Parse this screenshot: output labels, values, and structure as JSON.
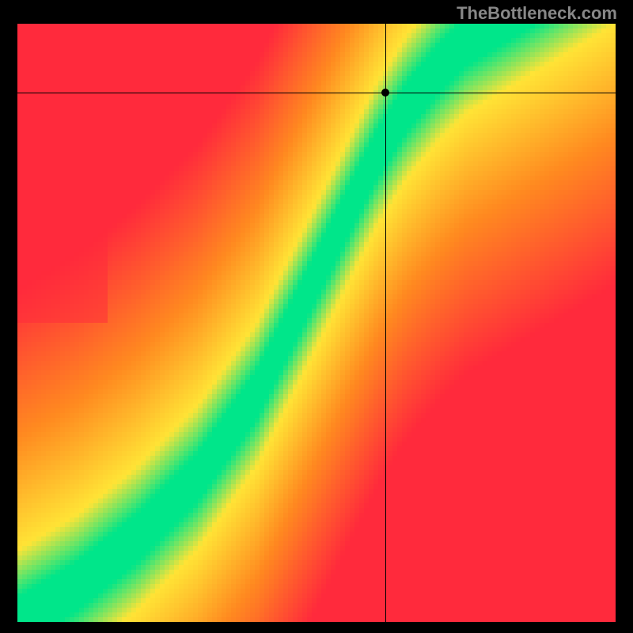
{
  "watermark": "TheBottleneck.com",
  "chart_data": {
    "type": "heatmap",
    "title": "",
    "xlabel": "",
    "ylabel": "",
    "xlim": [
      0,
      1
    ],
    "ylim": [
      0,
      1
    ],
    "grid": false,
    "crosshair": {
      "x": 0.615,
      "y": 0.885
    },
    "marker": {
      "x": 0.615,
      "y": 0.885
    },
    "optimal_curve_description": "Heatmap shading from red (poor) through orange/yellow to green (optimal) along a rising S-shaped ridge.",
    "optimal_curve_points": [
      {
        "x": 0.0,
        "y": 0.0
      },
      {
        "x": 0.1,
        "y": 0.06
      },
      {
        "x": 0.2,
        "y": 0.14
      },
      {
        "x": 0.3,
        "y": 0.24
      },
      {
        "x": 0.4,
        "y": 0.38
      },
      {
        "x": 0.45,
        "y": 0.48
      },
      {
        "x": 0.5,
        "y": 0.58
      },
      {
        "x": 0.55,
        "y": 0.68
      },
      {
        "x": 0.6,
        "y": 0.78
      },
      {
        "x": 0.65,
        "y": 0.86
      },
      {
        "x": 0.7,
        "y": 0.92
      },
      {
        "x": 0.75,
        "y": 0.97
      },
      {
        "x": 0.8,
        "y": 1.0
      }
    ],
    "color_scale": [
      {
        "stop": 0.0,
        "color": "#ff2a3c",
        "meaning": "worst"
      },
      {
        "stop": 0.4,
        "color": "#ff8a20",
        "meaning": "poor"
      },
      {
        "stop": 0.7,
        "color": "#ffe436",
        "meaning": "fair"
      },
      {
        "stop": 1.0,
        "color": "#00e68a",
        "meaning": "optimal"
      }
    ],
    "green_band_halfwidth": 0.04,
    "yellow_band_halfwidth": 0.12
  }
}
